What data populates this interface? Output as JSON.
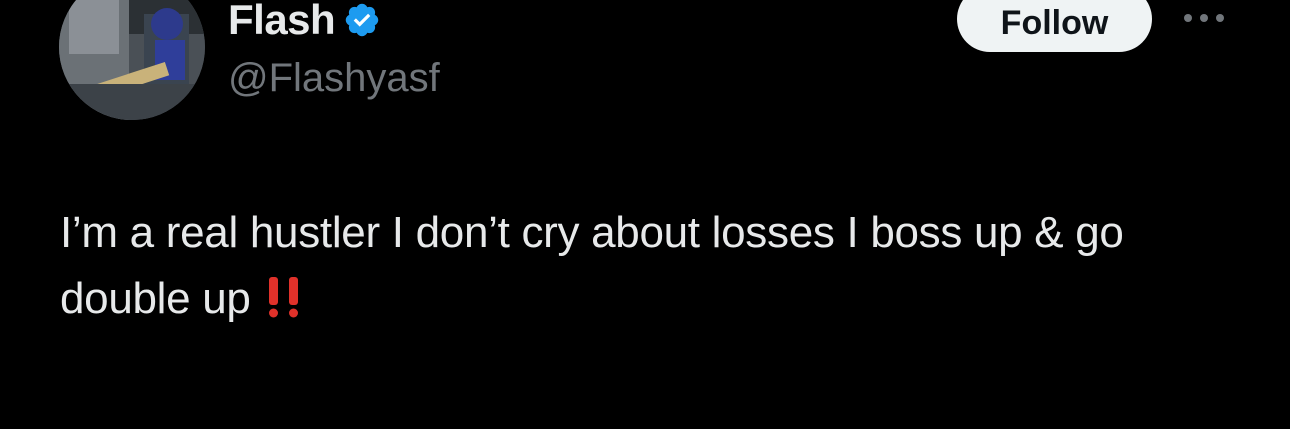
{
  "author": {
    "display_name": "Flash",
    "handle": "@Flashyasf",
    "verified": true,
    "verified_icon": "verified-badge-icon",
    "avatar_icon": "avatar-image"
  },
  "actions": {
    "follow_label": "Follow",
    "more_icon": "more-options-icon"
  },
  "tweet": {
    "text": "I’m a real hustler I don’t cry about losses I boss up & go double up",
    "emoji": "‼️",
    "emoji_icon": "double-exclamation-icon"
  },
  "colors": {
    "background": "#000000",
    "text_primary": "#e7e9ea",
    "text_secondary": "#71767b",
    "verified_blue": "#1d9bf0",
    "follow_bg": "#eff3f4",
    "follow_text": "#0f1419",
    "emoji_red": "#e0312a"
  }
}
